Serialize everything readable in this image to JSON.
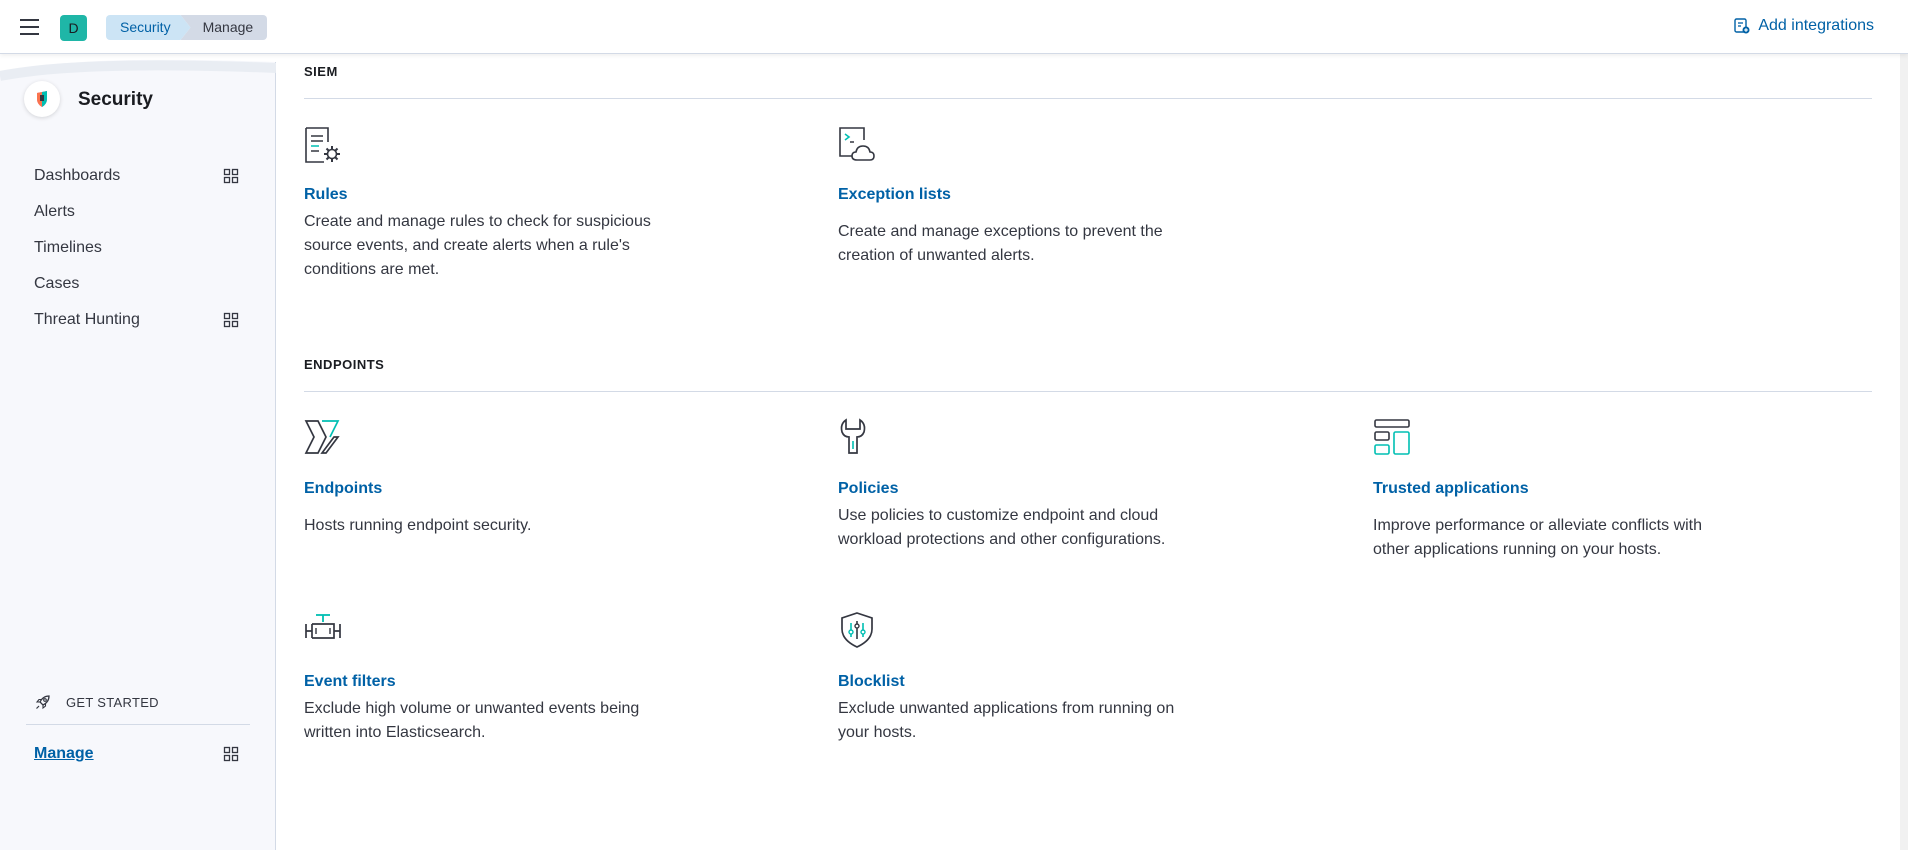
{
  "header": {
    "space_initial": "D",
    "breadcrumbs": [
      "Security",
      "Manage"
    ],
    "add_integrations": "Add integrations"
  },
  "sidebar": {
    "title": "Security",
    "items": [
      {
        "label": "Dashboards",
        "has_grid_icon": true
      },
      {
        "label": "Alerts",
        "has_grid_icon": false
      },
      {
        "label": "Timelines",
        "has_grid_icon": false
      },
      {
        "label": "Cases",
        "has_grid_icon": false
      },
      {
        "label": "Threat Hunting",
        "has_grid_icon": true
      }
    ],
    "get_started": "GET STARTED",
    "manage": "Manage"
  },
  "main": {
    "siem": {
      "title": "SIEM",
      "cards": [
        {
          "icon": "rules-icon",
          "title": "Rules",
          "description": "Create and manage rules to check for suspicious source events, and create alerts when a rule's conditions are met."
        },
        {
          "icon": "exception-lists-icon",
          "title": "Exception lists",
          "description": "Create and manage exceptions to prevent the creation of unwanted alerts."
        }
      ]
    },
    "endpoints": {
      "title": "ENDPOINTS",
      "cards": [
        {
          "icon": "endpoints-icon",
          "title": "Endpoints",
          "description": "Hosts running endpoint security."
        },
        {
          "icon": "policies-icon",
          "title": "Policies",
          "description": "Use policies to customize endpoint and cloud workload protections and other configurations."
        },
        {
          "icon": "trusted-applications-icon",
          "title": "Trusted applications",
          "description": "Improve performance or alleviate conflicts with other applications running on your hosts."
        },
        {
          "icon": "event-filters-icon",
          "title": "Event filters",
          "description": "Exclude high volume or unwanted events being written into Elasticsearch."
        },
        {
          "icon": "blocklist-icon",
          "title": "Blocklist",
          "description": "Exclude unwanted applications from running on your hosts."
        }
      ]
    }
  },
  "colors": {
    "link": "#0061a6",
    "accent_teal": "#1fb6a7",
    "text": "#343741",
    "border": "#d3dae6"
  }
}
